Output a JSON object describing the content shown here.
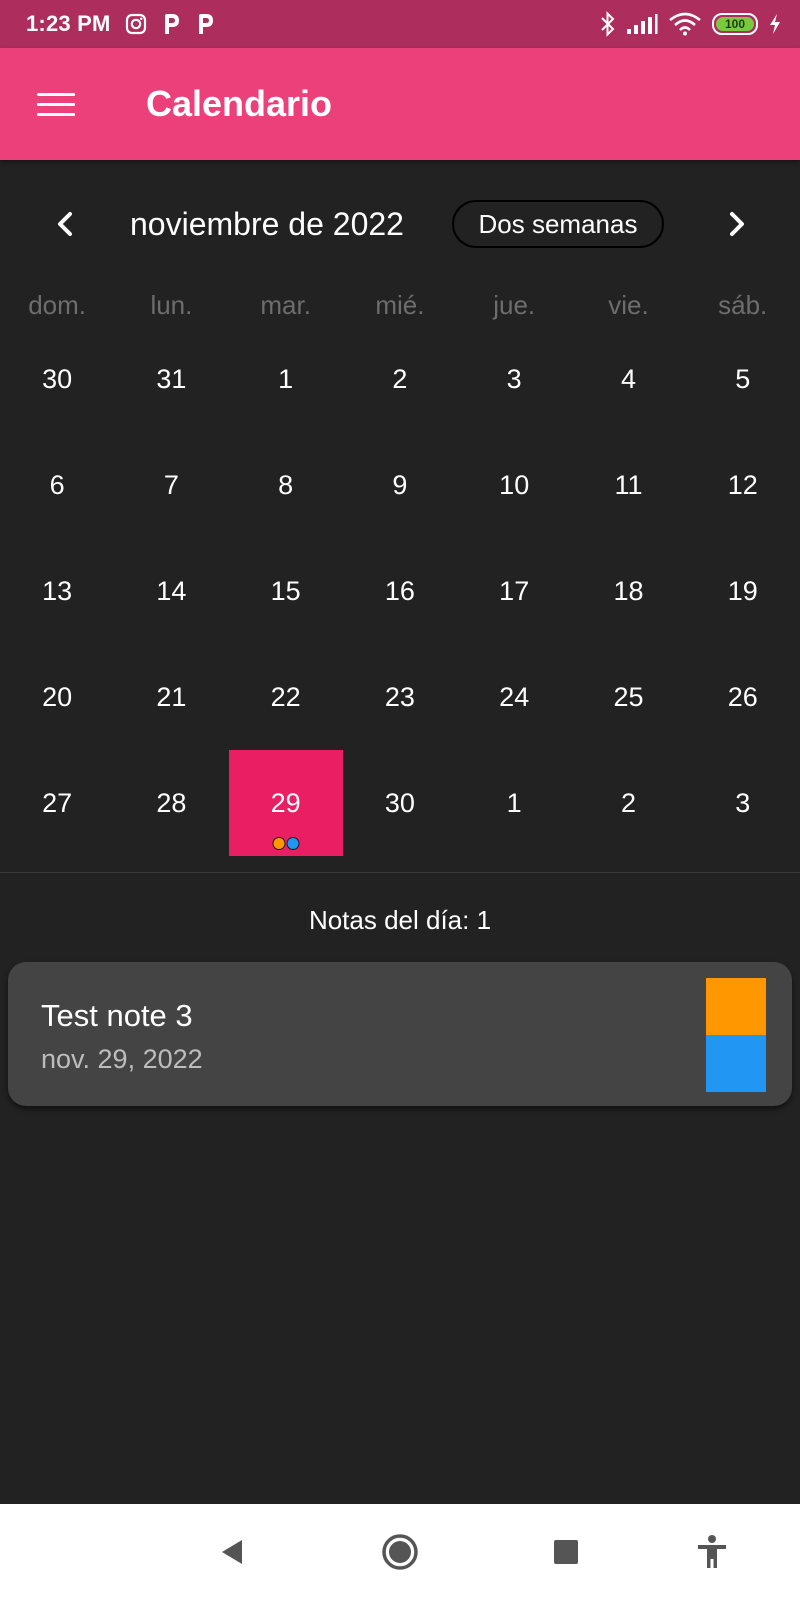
{
  "status_bar": {
    "time": "1:23 PM",
    "battery": "100",
    "left_icons": [
      "instagram-icon",
      "p-app-icon",
      "p-app-icon"
    ],
    "right_icons": [
      "bluetooth-icon",
      "signal-icon",
      "wifi-icon",
      "battery-icon",
      "charging-icon"
    ]
  },
  "app_bar": {
    "title": "Calendario",
    "menu_icon": "hamburger-menu-icon",
    "color": "#ec407a"
  },
  "calendar": {
    "month_title": "noviembre de 2022",
    "format_button": "Dos semanas",
    "prev_icon": "chevron-left-icon",
    "next_icon": "chevron-right-icon",
    "weekdays": [
      "dom.",
      "lun.",
      "mar.",
      "mié.",
      "jue.",
      "vie.",
      "sáb."
    ],
    "weeks": [
      [
        "30",
        "31",
        "1",
        "2",
        "3",
        "4",
        "5"
      ],
      [
        "6",
        "7",
        "8",
        "9",
        "10",
        "11",
        "12"
      ],
      [
        "13",
        "14",
        "15",
        "16",
        "17",
        "18",
        "19"
      ],
      [
        "20",
        "21",
        "22",
        "23",
        "24",
        "25",
        "26"
      ],
      [
        "27",
        "28",
        "29",
        "30",
        "1",
        "2",
        "3"
      ]
    ],
    "selected_day": "29",
    "selected_color": "#e91e63",
    "event_markers": [
      "#ff9800",
      "#2196f3"
    ]
  },
  "notes": {
    "count_label": "Notas del día: 1",
    "items": [
      {
        "title": "Test note 3",
        "date": "nov. 29, 2022",
        "colors": [
          "#ff9800",
          "#2196f3"
        ]
      }
    ]
  },
  "navigation_bar": {
    "items": [
      "back-icon",
      "home-icon",
      "recents-icon",
      "accessibility-icon"
    ]
  }
}
